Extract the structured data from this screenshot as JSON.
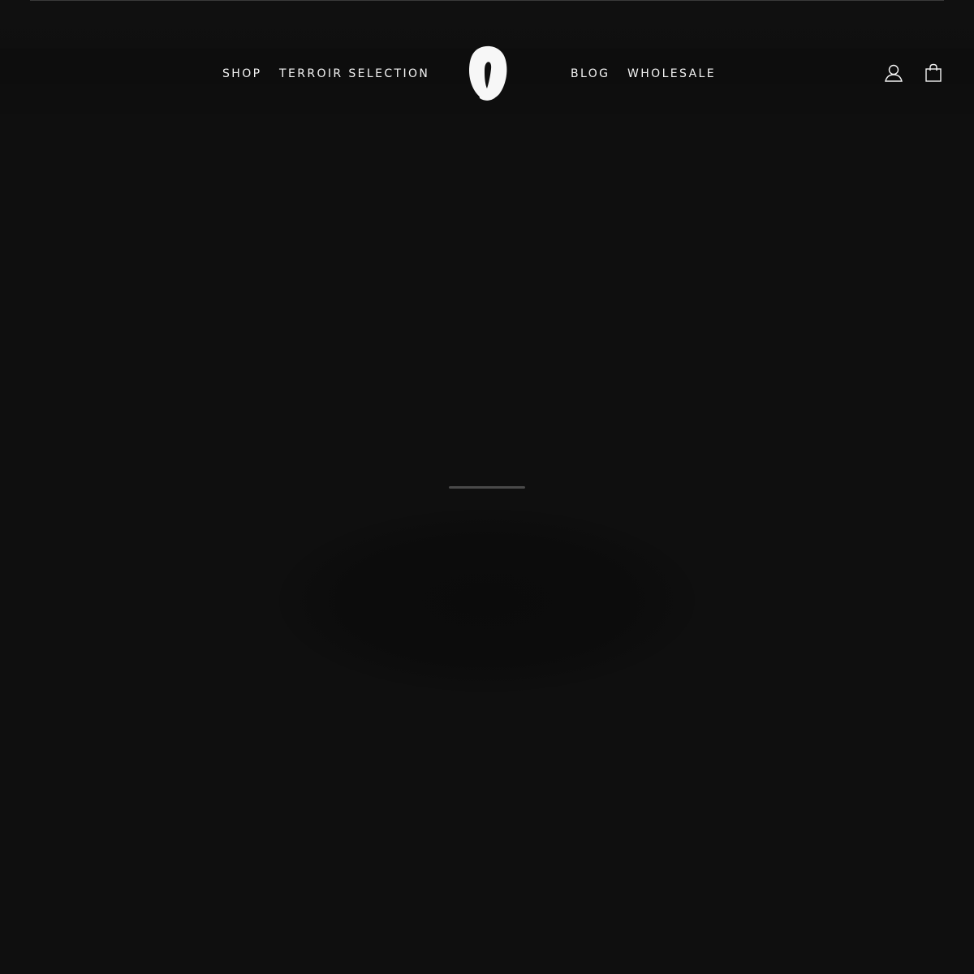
{
  "header": {
    "nav_left": [
      {
        "label": "SHOP"
      },
      {
        "label": "TERROIR SELECTION"
      }
    ],
    "nav_right": [
      {
        "label": "BLOG"
      },
      {
        "label": "WHOLESALE"
      }
    ],
    "logo_icon": "brand-logo-icon",
    "account_icon": "user-icon",
    "cart_icon": "shopping-bag-icon"
  },
  "hero": {
    "loader_progress": 1.0
  },
  "colors": {
    "background": "#0f0f0f",
    "text": "#f4f4f4",
    "loader": "#2b2b2b",
    "logo": "#f7f7f7"
  }
}
